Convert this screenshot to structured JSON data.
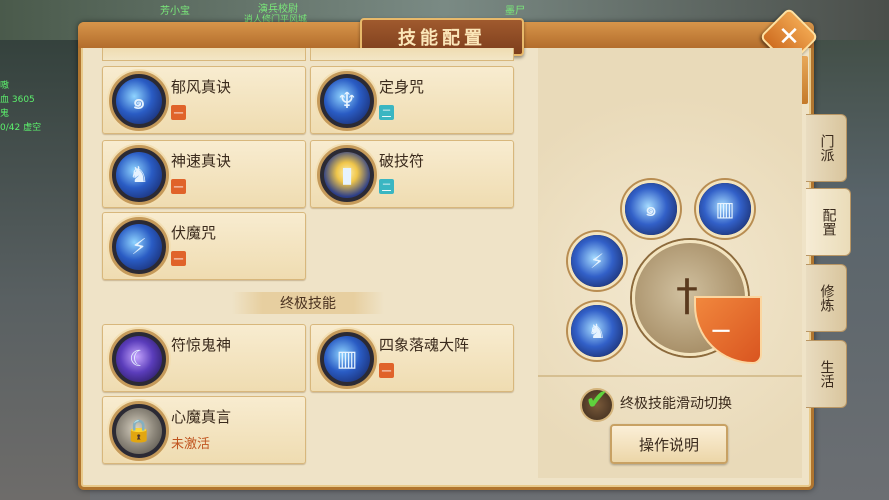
{
  "window": {
    "title": "技能配置",
    "close_label": "✕"
  },
  "hud": {
    "top_left_name": "芳小宝",
    "top_center_a": "演兵校尉",
    "top_center_b": "逍人修门平风城",
    "top_right": "墨尸",
    "left_lines": [
      "嗷",
      "血 3605",
      "鬼",
      "0/42 虚空"
    ]
  },
  "skills": {
    "normal": [
      {
        "name": "郁风真诀",
        "tag": "一",
        "tag_color": "orange",
        "icon": "whirl-icon"
      },
      {
        "name": "定身咒",
        "tag": "二",
        "tag_color": "teal",
        "icon": "figure-icon"
      },
      {
        "name": "神速真诀",
        "tag": "一",
        "tag_color": "orange",
        "icon": "runner-icon"
      },
      {
        "name": "破技符",
        "tag": "二",
        "tag_color": "teal",
        "icon": "talisman-icon"
      },
      {
        "name": "伏魔咒",
        "tag": "一",
        "tag_color": "orange",
        "icon": "claw-icon"
      }
    ],
    "ultimate_header": "终极技能",
    "ultimate": [
      {
        "name": "符惊鬼神",
        "tag": "",
        "icon": "purple-swirl-icon"
      },
      {
        "name": "四象落魂大阵",
        "tag": "一",
        "tag_color": "orange",
        "icon": "pillars-icon"
      },
      {
        "name": "心魔真言",
        "sub": "未激活",
        "icon": "lock-icon"
      }
    ]
  },
  "wheel": {
    "wedge_label": "一",
    "slots": [
      "whirl-icon",
      "pillars-icon",
      "claw-icon",
      "runner-icon"
    ]
  },
  "options": {
    "ultimate_swipe_label": "终极技能滑动切换",
    "ultimate_swipe_checked": true,
    "help_button": "操作说明"
  },
  "side_tabs": [
    {
      "label": "门派",
      "active": false
    },
    {
      "label": "配置",
      "active": true
    },
    {
      "label": "修炼",
      "active": false
    },
    {
      "label": "生活",
      "active": false
    }
  ],
  "colors": {
    "accent": "#d95520",
    "frame": "#b0752f",
    "panel": "#efe3c7",
    "tag_orange": "#e0632a",
    "tag_teal": "#3ab6c2"
  }
}
